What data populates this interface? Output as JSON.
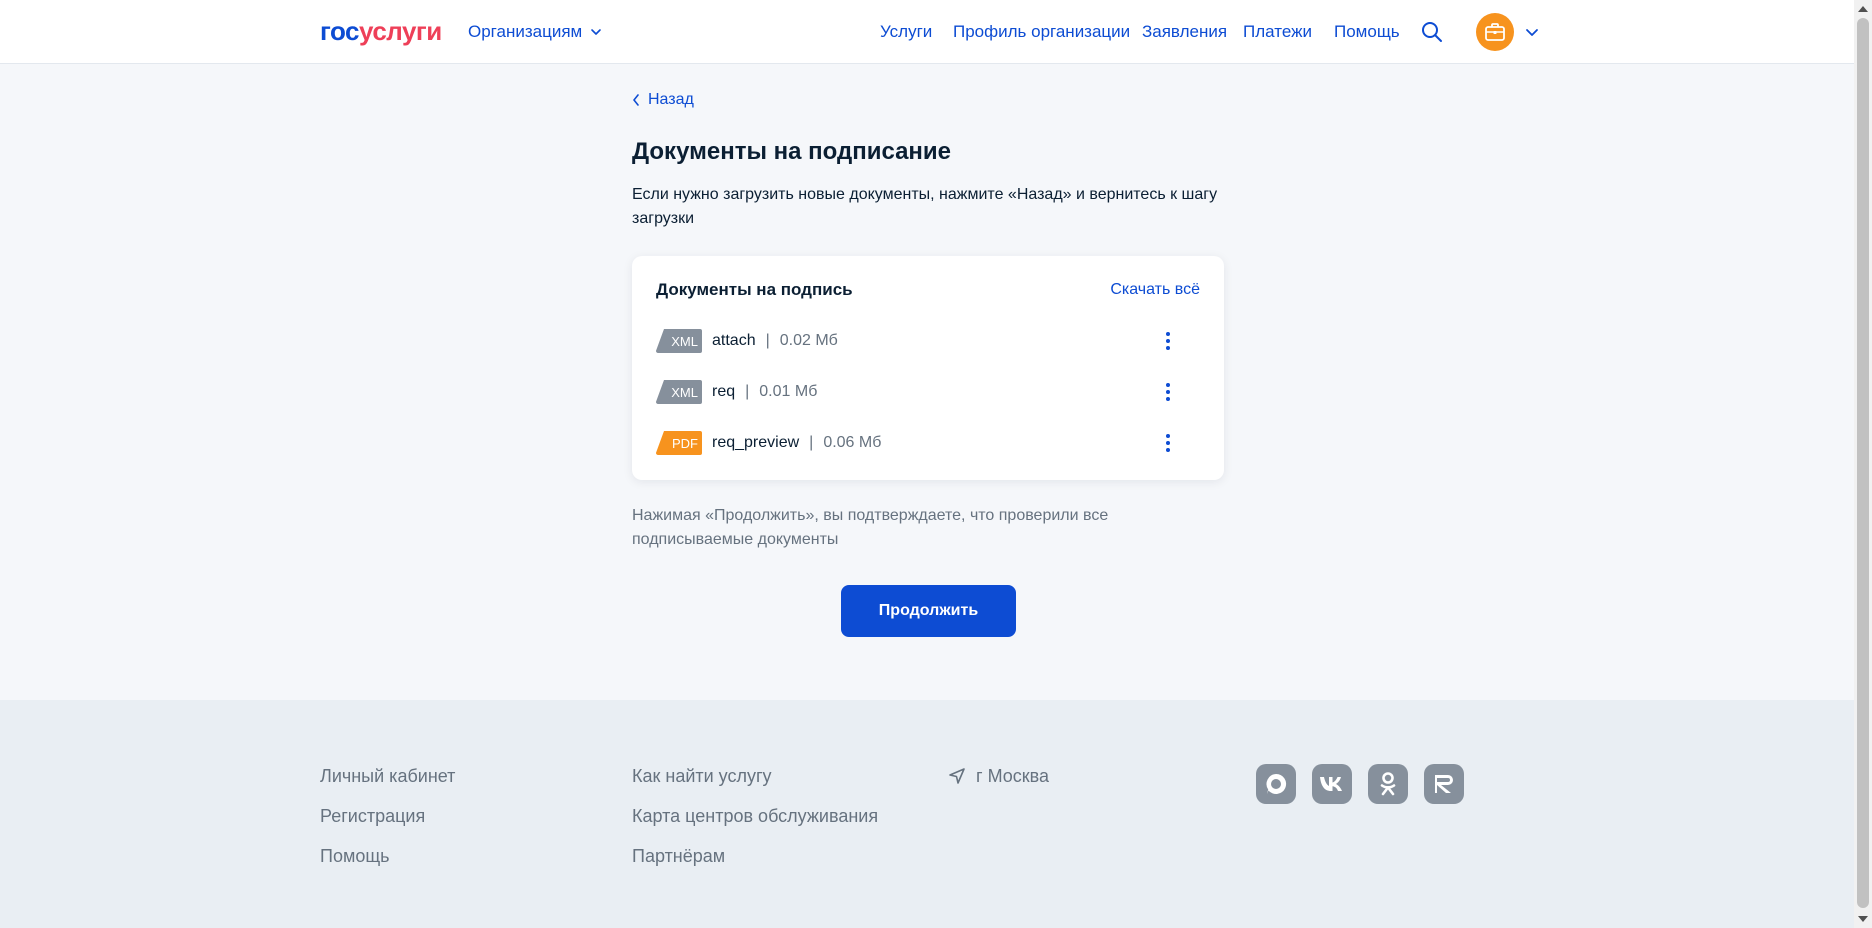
{
  "header": {
    "logo_part1": "гос",
    "logo_part2": "услуги",
    "org_menu_label": "Организациям",
    "nav": [
      {
        "label": "Услуги"
      },
      {
        "label": "Профиль организации"
      },
      {
        "label": "Заявления"
      },
      {
        "label": "Платежи"
      },
      {
        "label": "Помощь"
      }
    ],
    "icons": [
      "search-icon",
      "briefcase-icon",
      "chevron-down-icon"
    ],
    "avatar_color": "#f7931e"
  },
  "main": {
    "back_label": "Назад",
    "title": "Документы на подписание",
    "subtitle": "Если нужно загрузить новые документы, нажмите «Назад» и вернитесь к шагу загрузки",
    "card": {
      "title": "Документы на подпись",
      "download_all": "Скачать всё",
      "documents": [
        {
          "type": "XML",
          "name": "attach",
          "separator": "|",
          "size": "0.02 Мб",
          "badge_color": "#86909c"
        },
        {
          "type": "XML",
          "name": "req",
          "separator": "|",
          "size": "0.01 Мб",
          "badge_color": "#86909c"
        },
        {
          "type": "PDF",
          "name": "req_preview",
          "separator": "|",
          "size": "0.06 Мб",
          "badge_color": "#f7931e"
        }
      ]
    },
    "confirm_note": "Нажимая «Продолжить», вы подтверждаете, что проверили все подписываемые документы",
    "continue_label": "Продолжить"
  },
  "footer": {
    "col1": [
      "Личный кабинет",
      "Регистрация",
      "Помощь"
    ],
    "col2": [
      "Как найти услугу",
      "Карта центров обслуживания",
      "Партнёрам"
    ],
    "location": "г Москва",
    "social_icons": [
      "chat-icon",
      "vk-icon",
      "ok-icon",
      "rutube-icon"
    ]
  },
  "colors": {
    "accent": "#0d4cd3",
    "brand_red": "#ee3f58",
    "text": "#0b1f33",
    "muted": "#66727f",
    "page_bg": "#f5f7fa",
    "footer_bg": "#e9eef3"
  }
}
